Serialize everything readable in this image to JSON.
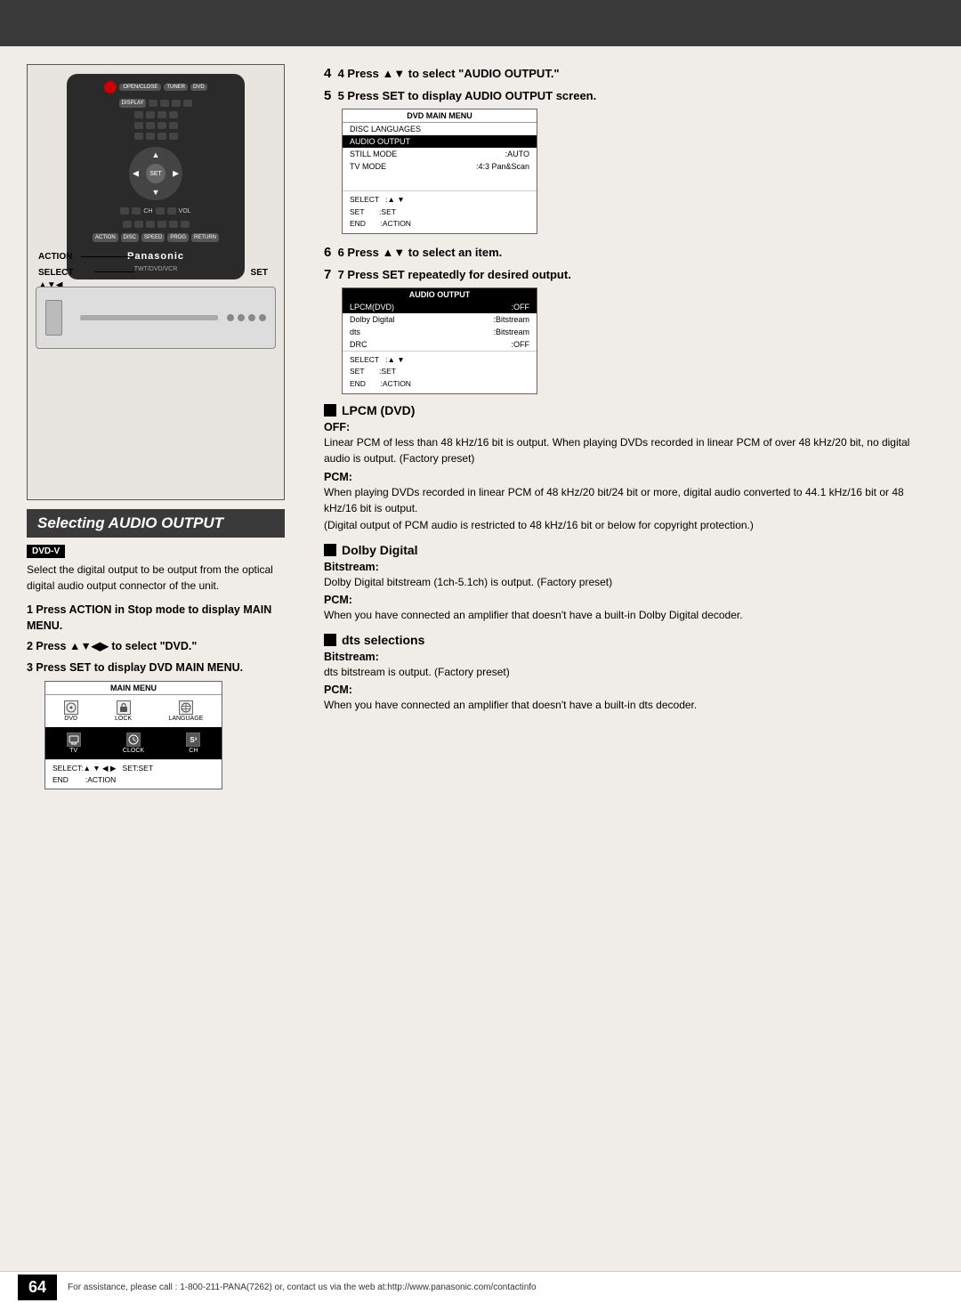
{
  "topBar": {},
  "leftCol": {
    "actionLabel": "ACTION",
    "selectLabel": "SELECT",
    "setLabel": "SET",
    "arrowLabel": "▲▼◀",
    "sectionTitle": "Selecting AUDIO OUTPUT",
    "dvdVBadge": "DVD-V",
    "introText": "Select the digital output to be output from the optical digital audio output connector of the unit.",
    "step1": "1  Press ACTION in Stop mode to display MAIN MENU.",
    "step2": "2  Press ▲▼◀▶ to select \"DVD.\"",
    "step3": "3  Press SET to display DVD MAIN MENU.",
    "mainMenu": {
      "title": "MAIN MENU",
      "icons": [
        "DVD",
        "LOCK",
        "LANGUAGE",
        "TV",
        "CLOCK",
        "CH"
      ],
      "selectRow": "SELECT:▲ ▼ ◀ ▶   SET:SET",
      "endRow": "END         :ACTION"
    }
  },
  "rightCol": {
    "step4": "4  Press ▲▼ to select \"AUDIO OUTPUT.\"",
    "step5": "5  Press SET to display AUDIO OUTPUT screen.",
    "dvdMainMenu": {
      "title": "DVD MAIN MENU",
      "rows": [
        {
          "label": "DISC LANGUAGES",
          "value": ""
        },
        {
          "label": "AUDIO OUTPUT",
          "value": "",
          "highlighted": true
        },
        {
          "label": "STILL MODE",
          "value": ":AUTO"
        },
        {
          "label": "TV MODE",
          "value": ":4:3 Pan&Scan"
        }
      ],
      "footer": [
        "SELECT   :▲ ▼",
        "SET       :SET",
        "END       :ACTION"
      ]
    },
    "step6": "6  Press ▲▼ to select an item.",
    "step7": "7  Press SET repeatedly for desired output.",
    "audioOutput": {
      "title": "AUDIO OUTPUT",
      "rows": [
        {
          "label": "LPCM(DVD)",
          "value": ":OFF",
          "highlighted": true
        },
        {
          "label": "Dolby Digital",
          "value": ":Bitstream"
        },
        {
          "label": "dts",
          "value": ":Bitstream"
        },
        {
          "label": "DRC",
          "value": ":OFF"
        }
      ],
      "footer": [
        "SELECT   :▲ ▼",
        "SET       :SET",
        "END       :ACTION"
      ]
    },
    "lpcmTitle": "LPCM (DVD)",
    "offLabel": "OFF:",
    "offText": "Linear PCM of less than 48 kHz/16 bit is output. When playing DVDs recorded in linear PCM of over 48 kHz/20 bit, no digital audio is output. (Factory preset)",
    "pcmLabel1": "PCM:",
    "pcmText1": "When playing DVDs recorded in linear PCM of 48 kHz/20 bit/24 bit or more, digital audio converted to 44.1 kHz/16 bit or 48 kHz/16 bit is output.\n(Digital output of PCM audio is restricted to 48 kHz/16 bit or below for copyright protection.)",
    "dolbyTitle": "Dolby Digital",
    "bitstreamLabel": "Bitstream:",
    "bitstreamText": "Dolby Digital bitstream (1ch-5.1ch) is output. (Factory preset)",
    "pcmLabel2": "PCM:",
    "pcmText2": "When you have connected an amplifier that doesn't have a built-in Dolby Digital decoder.",
    "dtsTitle": "dts selections",
    "bitstream2Label": "Bitstream:",
    "bitstream2Text": "dts bitstream is output. (Factory preset)",
    "pcmLabel3": "PCM:",
    "pcmText3": "When you have connected an amplifier that doesn't have a built-in dts decoder."
  },
  "footer": {
    "pageNumber": "64",
    "helpText": "For assistance, please call : 1-800-211-PANA(7262) or, contact us via the web at:http://www.panasonic.com/contactinfo"
  }
}
